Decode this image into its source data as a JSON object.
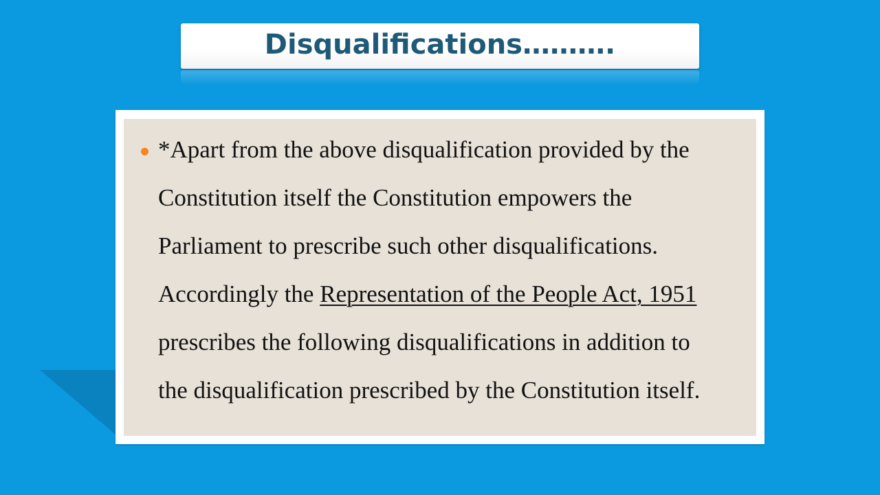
{
  "slide": {
    "title": "Disqualifications……….",
    "body": {
      "line1": "*Apart from the above disqualification provided by the",
      "line2": "Constitution itself the Constitution empowers the",
      "line3": "Parliament to prescribe such other disqualifications.",
      "line4_prefix": "Accordingly the ",
      "line4_link": "Representation of the People Act, 1951",
      "line5": "prescribes the following disqualifications in addition to",
      "line6": "the disqualification prescribed by the Constitution itself."
    }
  },
  "colors": {
    "background": "#0b99df",
    "title_text": "#1e5a77",
    "card_fill": "#e7e1d8",
    "bullet": "#f7841e"
  }
}
